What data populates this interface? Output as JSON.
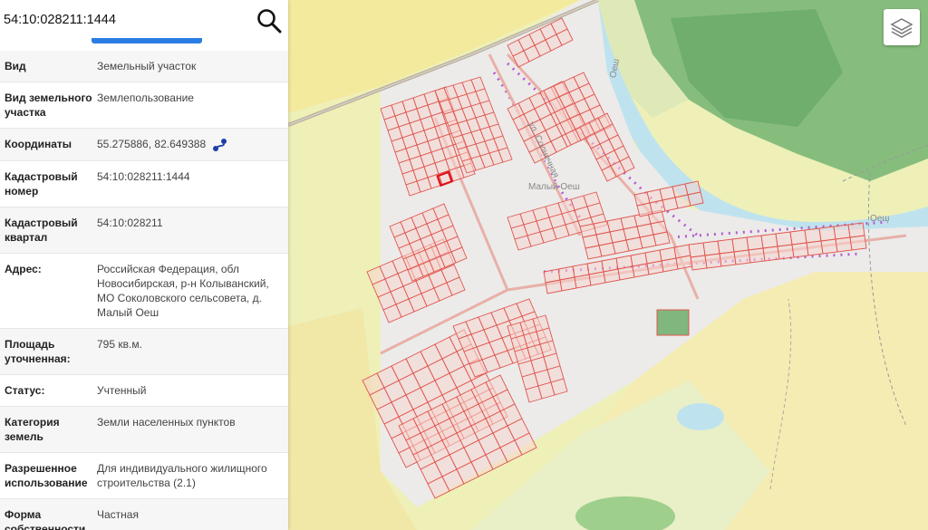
{
  "search": {
    "value": "54:10:028211:1444"
  },
  "info": {
    "rows": [
      {
        "label": "Вид",
        "value": "Земельный участок"
      },
      {
        "label": "Вид земельного участка",
        "value": "Землепользование"
      },
      {
        "label": "Координаты",
        "value": "55.275886, 82.649388"
      },
      {
        "label": "Кадастровый номер",
        "value": "54:10:028211:1444"
      },
      {
        "label": "Кадастровый квартал",
        "value": "54:10:028211"
      },
      {
        "label": "Адрес:",
        "value": "Российская Федерация, обл Новосибирская, р-н Колыванский, МО Соколовского сельсовета, д. Малый Оеш"
      },
      {
        "label": "Площадь уточненная:",
        "value": "795 кв.м."
      },
      {
        "label": "Статус:",
        "value": "Учтенный"
      },
      {
        "label": "Категория земель",
        "value": "Земли населенных пунктов"
      },
      {
        "label": "Разрешенное использование",
        "value": "Для индивидуального жилищного строительства (2.1)"
      },
      {
        "label": "Форма собственности",
        "value": "Частная"
      }
    ]
  },
  "map": {
    "labels": {
      "village": "Малый Оеш",
      "river_top": "Оеш",
      "river_right": "Оеш",
      "street": "ул. Солнечная"
    },
    "colors": {
      "parcel_stroke": "#e0564e",
      "parcel_fill": "#f6d5cf",
      "selected_parcel": "#e0101a",
      "river": "#bfe3ee",
      "forest": "#7fb77e",
      "field": "#f1e6a0",
      "zone_purple": "#b24ccd",
      "accent_blue": "#2b7de3"
    }
  }
}
